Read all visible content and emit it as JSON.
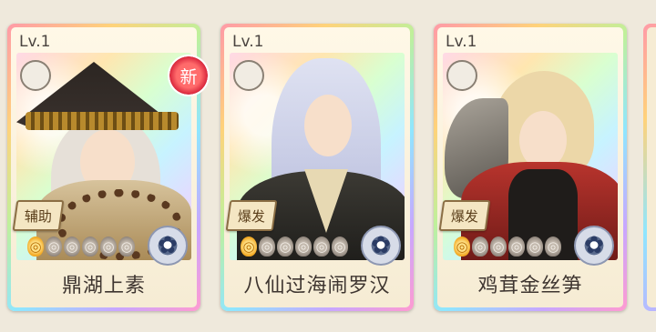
{
  "cards": [
    {
      "level": "Lv.1",
      "type": "辅助",
      "name": "鼎湖上素",
      "stars_filled": 1,
      "stars_total": 6,
      "new_tag": "新"
    },
    {
      "level": "Lv.1",
      "type": "爆发",
      "name": "八仙过海闹罗汉",
      "stars_filled": 1,
      "stars_total": 6
    },
    {
      "level": "Lv.1",
      "type": "爆发",
      "name": "鸡茸金丝笋",
      "stars_filled": 1,
      "stars_total": 6
    }
  ],
  "colors": {
    "frame_rainbow": [
      "#ff9aa8",
      "#ffd27a",
      "#bff09b",
      "#8fe6ff",
      "#c7a7ff"
    ],
    "badge_border": "#8b6e44",
    "text_dark": "#3e3530"
  },
  "icons": {
    "star_on": "flame-star-icon",
    "star_off": "flame-star-empty-icon",
    "element": "flower-emblem-icon",
    "slot": "stand-slot-icon"
  }
}
